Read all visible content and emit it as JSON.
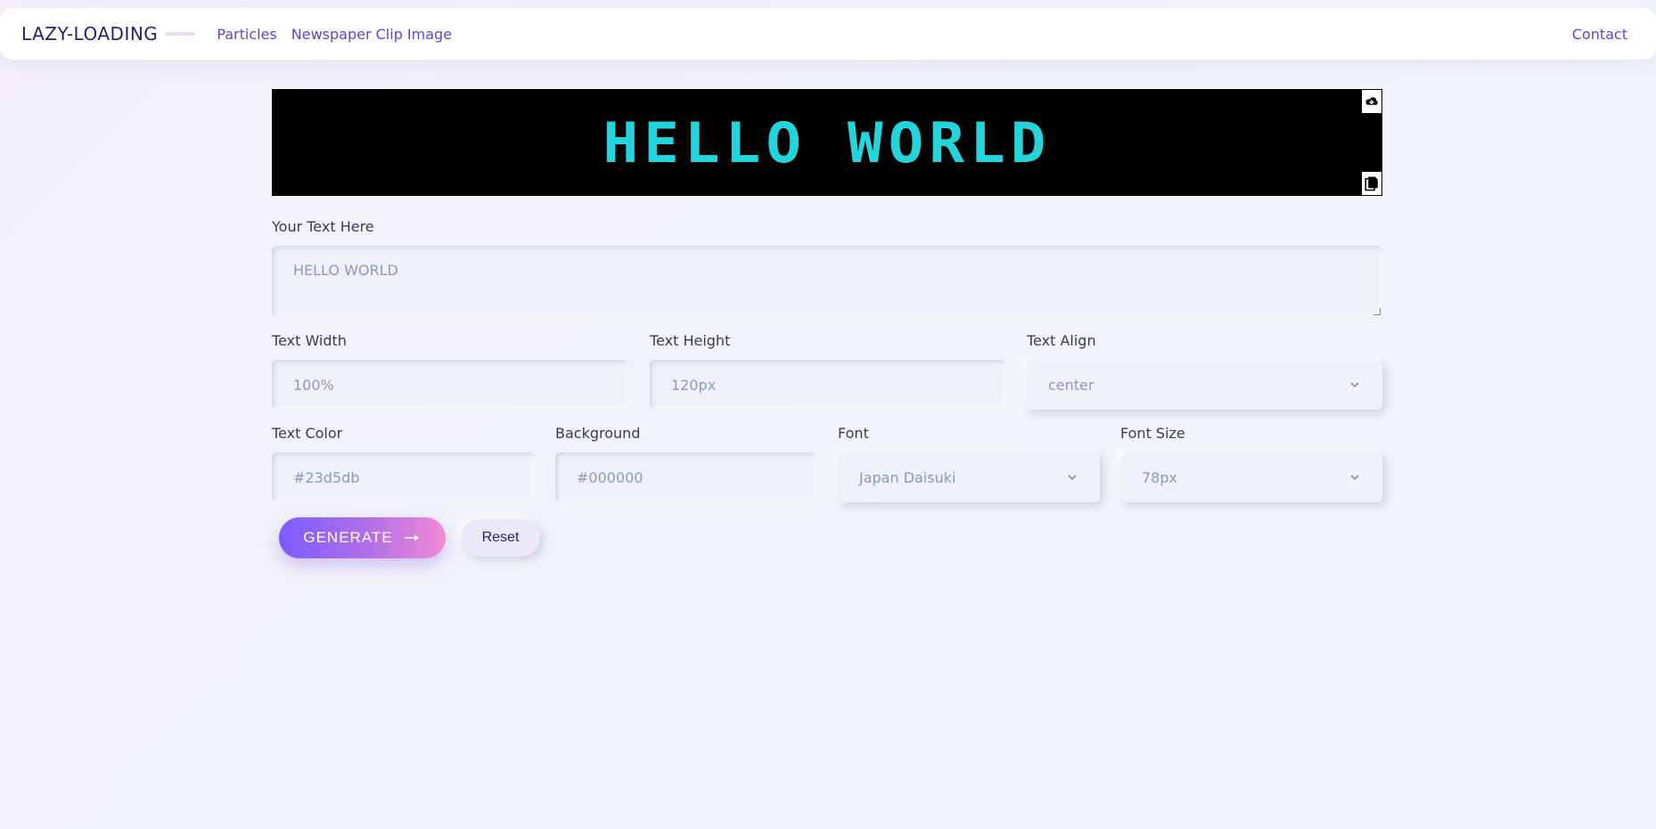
{
  "nav": {
    "brand": "LAZY-LOADING",
    "links": [
      "Particles",
      "Newspaper Clip Image"
    ],
    "contact": "Contact"
  },
  "preview": {
    "text": "HELLO WORLD",
    "text_color": "#23d5db",
    "background": "#000000",
    "download_icon": "cloud-download-icon",
    "copy_icon": "copy-icon"
  },
  "form": {
    "text": {
      "label": "Your Text Here",
      "placeholder": "HELLO WORLD"
    },
    "width": {
      "label": "Text Width",
      "placeholder": "100%"
    },
    "height": {
      "label": "Text Height",
      "placeholder": "120px"
    },
    "align": {
      "label": "Text Align",
      "value": "center"
    },
    "color": {
      "label": "Text Color",
      "placeholder": "#23d5db"
    },
    "background": {
      "label": "Background",
      "placeholder": "#000000"
    },
    "font": {
      "label": "Font",
      "value": "Japan Daisuki"
    },
    "font_size": {
      "label": "Font Size",
      "value": "78px"
    }
  },
  "buttons": {
    "generate": "GENERATE",
    "reset": "Reset"
  },
  "colors": {
    "accent": "#5b47cf",
    "generate_gradient_start": "#7a5cff",
    "generate_gradient_end": "#f08ad6"
  }
}
